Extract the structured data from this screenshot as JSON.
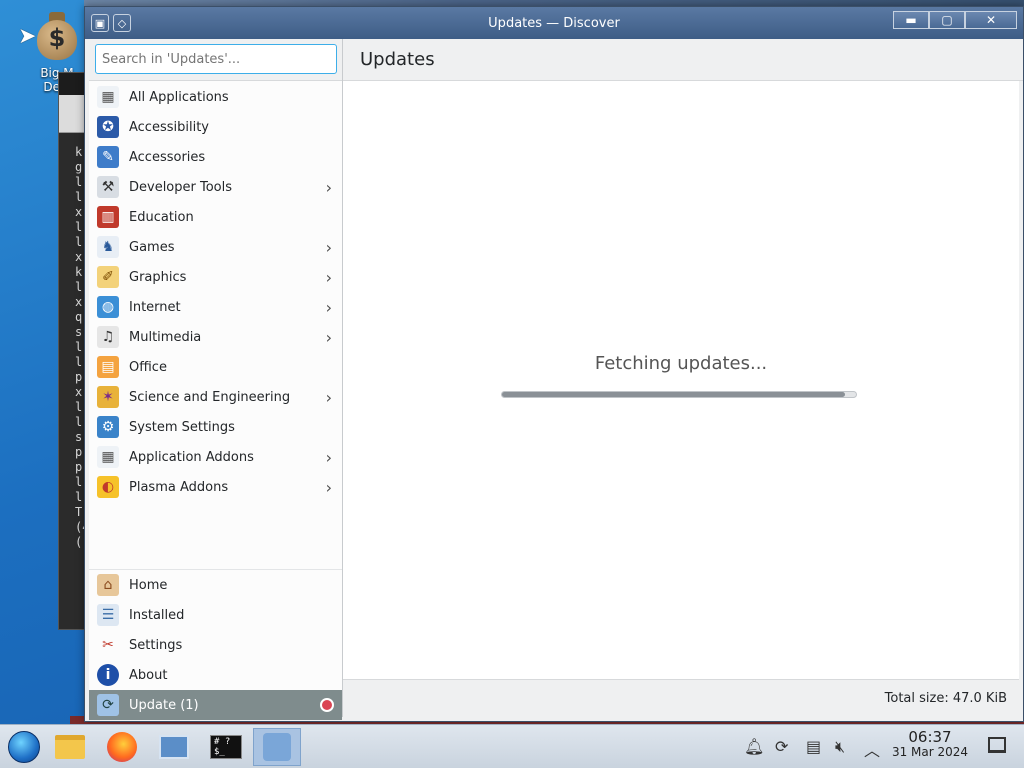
{
  "desktop": {
    "icon_label_line1": "Big M",
    "icon_label_line2": "Dele"
  },
  "terminal_lines": [
    "k",
    "g",
    "l",
    "l",
    "x",
    "l",
    "l",
    "x",
    "k",
    "l",
    "x",
    "q",
    "s",
    "l",
    "l",
    "p",
    "x",
    "l",
    "l",
    "s",
    "p",
    "p",
    "l",
    "l",
    "T",
    "(4",
    "("
  ],
  "window": {
    "title": "Updates — Discover",
    "buttons": {
      "minimize": "▬",
      "maximize": "▢",
      "close": "✕"
    }
  },
  "search": {
    "placeholder": "Search in 'Updates'..."
  },
  "categories": [
    {
      "label": "All Applications",
      "icon": "grid-icon",
      "has_submenu": false
    },
    {
      "label": "Accessibility",
      "icon": "accessibility-icon",
      "has_submenu": false
    },
    {
      "label": "Accessories",
      "icon": "accessories-icon",
      "has_submenu": false
    },
    {
      "label": "Developer Tools",
      "icon": "developer-tools-icon",
      "has_submenu": true
    },
    {
      "label": "Education",
      "icon": "education-icon",
      "has_submenu": false
    },
    {
      "label": "Games",
      "icon": "games-icon",
      "has_submenu": true
    },
    {
      "label": "Graphics",
      "icon": "graphics-icon",
      "has_submenu": true
    },
    {
      "label": "Internet",
      "icon": "internet-icon",
      "has_submenu": true
    },
    {
      "label": "Multimedia",
      "icon": "multimedia-icon",
      "has_submenu": true
    },
    {
      "label": "Office",
      "icon": "office-icon",
      "has_submenu": false
    },
    {
      "label": "Science and Engineering",
      "icon": "science-icon",
      "has_submenu": true
    },
    {
      "label": "System Settings",
      "icon": "system-settings-icon",
      "has_submenu": false
    },
    {
      "label": "Application Addons",
      "icon": "addons-icon",
      "has_submenu": true
    },
    {
      "label": "Plasma Addons",
      "icon": "plasma-icon",
      "has_submenu": true
    }
  ],
  "bottom_nav": {
    "home": "Home",
    "installed": "Installed",
    "settings": "Settings",
    "about": "About",
    "update": "Update (1)"
  },
  "main": {
    "header": "Updates",
    "status": "Fetching updates...",
    "progress": 0.97,
    "total_size": "Total size: 47.0 KiB"
  },
  "taskbar": {
    "time": "06:37",
    "date": "31 Mar 2024",
    "terminal_glyph": "# ?$_"
  },
  "colors": {
    "accent": "#3daee9",
    "selected_bg": "#7f8c8d",
    "badge": "#da4453"
  }
}
